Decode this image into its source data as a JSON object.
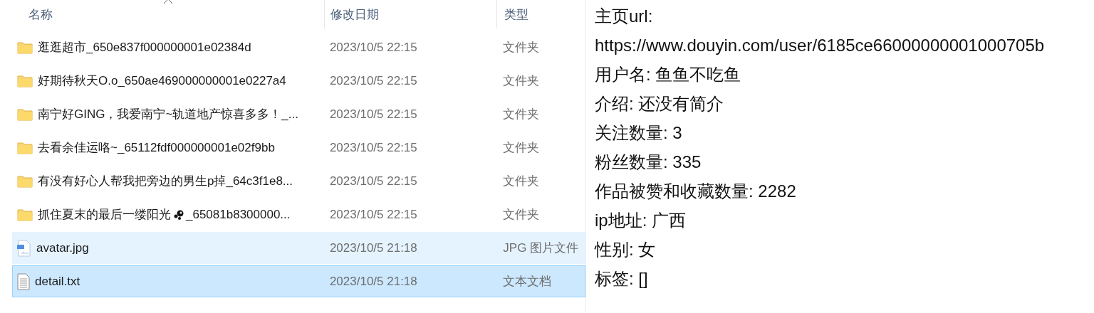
{
  "file_list": {
    "columns": [
      {
        "label": "名称",
        "sorted": true
      },
      {
        "label": "修改日期",
        "sorted": false
      },
      {
        "label": "类型",
        "sorted": false
      }
    ],
    "rows": [
      {
        "kind": "folder",
        "name": "逛逛超市_650e837f000000001e02384d",
        "date": "2023/10/5 22:15",
        "type": "文件夹",
        "hovered": false,
        "selected": false
      },
      {
        "kind": "folder",
        "name": "好期待秋天O.o_650ae469000000001e0227a4",
        "date": "2023/10/5 22:15",
        "type": "文件夹",
        "hovered": false,
        "selected": false
      },
      {
        "kind": "folder",
        "name": "南宁好GING，我爱南宁~轨道地产惊喜多多！_...",
        "date": "2023/10/5 22:15",
        "type": "文件夹",
        "hovered": false,
        "selected": false
      },
      {
        "kind": "folder",
        "name": "去看余佳运咯~_65112fdf000000001e02f9bb",
        "date": "2023/10/5 22:15",
        "type": "文件夹",
        "hovered": false,
        "selected": false
      },
      {
        "kind": "folder",
        "name": "有没有好心人帮我把旁边的男生p掉_64c3f1e8...",
        "date": "2023/10/5 22:15",
        "type": "文件夹",
        "hovered": false,
        "selected": false
      },
      {
        "kind": "folder",
        "name": "抓住夏末的最后一缕阳光",
        "name_after_emoji": "_65081b8300000...",
        "date": "2023/10/5 22:15",
        "type": "文件夹",
        "hovered": false,
        "selected": false
      },
      {
        "kind": "image",
        "name": "avatar.jpg",
        "date": "2023/10/5 21:18",
        "type": "JPG 图片文件",
        "hovered": true,
        "selected": false
      },
      {
        "kind": "text",
        "name": "detail.txt",
        "date": "2023/10/5 21:18",
        "type": "文本文档",
        "hovered": false,
        "selected": true
      }
    ]
  },
  "text_preview": {
    "lines": [
      "主页url:",
      "https://www.douyin.com/user/6185ce66000000001000705b",
      "用户名: 鱼鱼不吃鱼",
      "介绍: 还没有简介",
      "关注数量: 3",
      "粉丝数量: 335",
      "作品被赞和收藏数量: 2282",
      "ip地址: 广西",
      "性别: 女",
      "标签: []"
    ]
  }
}
